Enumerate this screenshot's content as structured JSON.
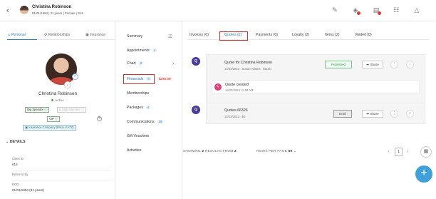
{
  "header": {
    "name": "Christina Robinson",
    "subtitle": "01/01/1994 | 31 years | Female | 812"
  },
  "left": {
    "tabs": [
      "Personal",
      "Relationships",
      "Insurance"
    ],
    "customer_name": "Christina Robinson",
    "status": "Active",
    "tags": [
      "Big Spender",
      "Loyalty Member",
      "VIP"
    ],
    "insurance": "Insurance Company (PAUL KATZ)",
    "details_title": "DETAILS",
    "details": [
      {
        "label": "Client ID",
        "value": "812"
      },
      {
        "label": "Referred By",
        "value": ""
      },
      {
        "label": "DOB",
        "value": "01/01/1994 (31 years)"
      }
    ]
  },
  "nav": {
    "items": [
      {
        "label": "Summary",
        "count": ""
      },
      {
        "label": "Appointments",
        "count": "4"
      },
      {
        "label": "Chart",
        "count": "2"
      },
      {
        "label": "Financials",
        "count": "6"
      },
      {
        "label": "Memberships",
        "count": ""
      },
      {
        "label": "Packages",
        "count": "4"
      },
      {
        "label": "Communications",
        "count": "29"
      },
      {
        "label": "Gift Vouchers",
        "count": ""
      },
      {
        "label": "Activities",
        "count": ""
      }
    ],
    "financial_amount": "$240.00"
  },
  "tabs": [
    "Invoices (6)",
    "Quotes (2)",
    "Payments (6)",
    "Loyalty (2)",
    "Items (2)",
    "Voided (0)"
  ],
  "quotes": [
    {
      "title": "Quote for Christina Robinson",
      "meta": "12/23/2023 · Susan Adams · $1100",
      "status": "Published",
      "share": "Share",
      "event_title": "Quote created",
      "event_time": "12/23/2023 11:59 AM"
    },
    {
      "title": "Quotes 66326",
      "meta": "12/23/2023 · $0",
      "status": "Draft",
      "share": "Share"
    }
  ],
  "pagination": {
    "showing_prefix": "SHOWING",
    "shown": "2",
    "results_of": "RESULTS FROM",
    "total": "2",
    "rows_label": "ROWS PER PAGE",
    "rows": "50",
    "page": "1"
  },
  "colors": {
    "accent": "#2f7fc1",
    "highlight": "#d32f2f",
    "fab": "#3fa1dc"
  }
}
